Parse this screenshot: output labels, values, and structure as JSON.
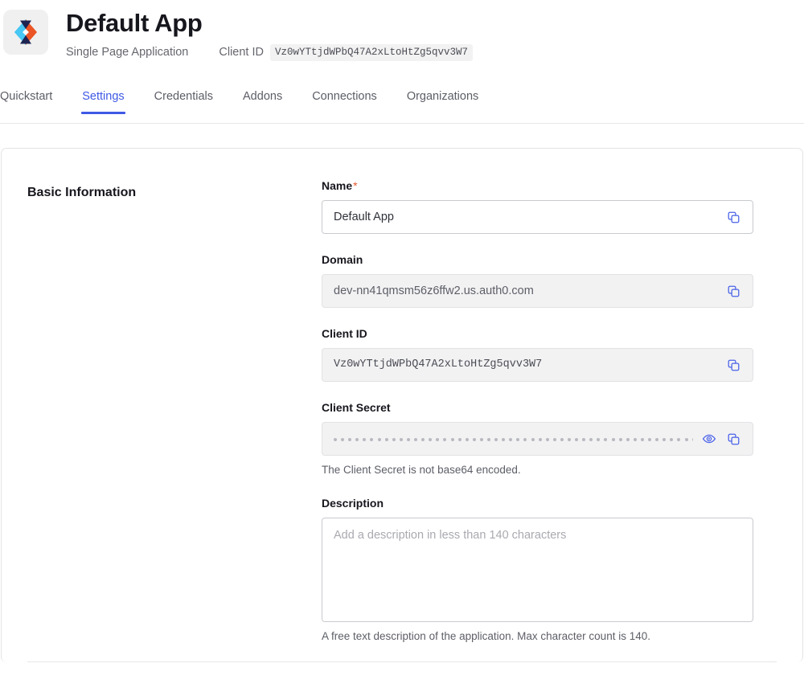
{
  "header": {
    "logo_icon": "auth0-hexagon-logo",
    "title": "Default App",
    "app_type": "Single Page Application",
    "client_id_label": "Client ID",
    "client_id_value": "Vz0wYTtjdWPbQ47A2xLtoHtZg5qvv3W7"
  },
  "tabs": [
    {
      "label": "Quickstart",
      "active": false
    },
    {
      "label": "Settings",
      "active": true
    },
    {
      "label": "Credentials",
      "active": false
    },
    {
      "label": "Addons",
      "active": false
    },
    {
      "label": "Connections",
      "active": false
    },
    {
      "label": "Organizations",
      "active": false
    }
  ],
  "section": {
    "title": "Basic Information"
  },
  "fields": {
    "name": {
      "label": "Name",
      "required_marker": "*",
      "value": "Default App",
      "copy_icon": "copy-icon"
    },
    "domain": {
      "label": "Domain",
      "value": "dev-nn41qmsm56z6ffw2.us.auth0.com",
      "copy_icon": "copy-icon"
    },
    "client_id": {
      "label": "Client ID",
      "value": "Vz0wYTtjdWPbQ47A2xLtoHtZg5qvv3W7",
      "copy_icon": "copy-icon"
    },
    "client_secret": {
      "label": "Client Secret",
      "masked_dot_count": 58,
      "reveal_icon": "eye-icon",
      "copy_icon": "copy-icon",
      "help": "The Client Secret is not base64 encoded."
    },
    "description": {
      "label": "Description",
      "value": "",
      "placeholder": "Add a description in less than 140 characters",
      "help": "A free text description of the application. Max character count is 140."
    }
  },
  "colors": {
    "accent": "#3f59e4",
    "icon_blue": "#4a62e8",
    "required_star": "#e4572e",
    "text_primary": "#16161d",
    "text_muted": "#65676e",
    "logo_cyan": "#47c7f4",
    "logo_orange": "#eb5424",
    "logo_navy": "#1d2452"
  }
}
